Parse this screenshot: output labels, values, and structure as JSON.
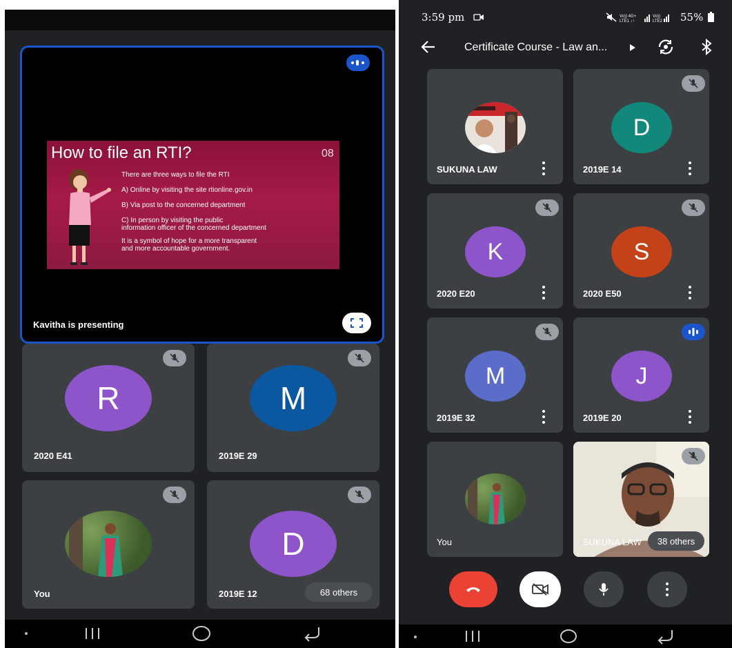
{
  "left": {
    "presentation": {
      "slide_title": "How to file an RTI?",
      "slide_number": "08",
      "slide_lines": [
        "There are three ways to file the RTI",
        "A) Online by visiting the site  rtionline.gov.in",
        "B) Via post to the concerned department",
        "C) In person by visiting the public",
        "information officer of the concerned department",
        "It is a symbol of hope for a more transparent",
        "and more accountable government."
      ],
      "presenter_label": "Kavitha is presenting"
    },
    "tiles": [
      {
        "name": "2020 E41",
        "initial": "R",
        "color": "#8e54c9"
      },
      {
        "name": "2019E 29",
        "initial": "M",
        "color": "#0b57a0"
      },
      {
        "name": "You"
      },
      {
        "name": "2019E 12",
        "initial": "D",
        "color": "#8e54c9"
      }
    ],
    "others_label": "68 others"
  },
  "right": {
    "status": {
      "time": "3:59 pm",
      "battery": "55%"
    },
    "header": {
      "title": "Certificate Course - Law an..."
    },
    "tiles": [
      {
        "name": "SUKUNA LAW"
      },
      {
        "name": "2019E 14",
        "initial": "D",
        "color": "#12887a"
      },
      {
        "name": "2020 E20",
        "initial": "K",
        "color": "#8e54c9"
      },
      {
        "name": "2020 E50",
        "initial": "S",
        "color": "#c4421a"
      },
      {
        "name": "2019E 32",
        "initial": "M",
        "color": "#5b6dc9"
      },
      {
        "name": "2019E 20",
        "initial": "J",
        "color": "#8e54c9"
      },
      {
        "name": "You"
      },
      {
        "name": "SUKUNA LAW"
      }
    ],
    "others_label": "38 others"
  },
  "colors": {
    "end_call": "#ea4335",
    "tile": "#3c4043",
    "speaking": "#1a56c9",
    "background": "#202124"
  }
}
